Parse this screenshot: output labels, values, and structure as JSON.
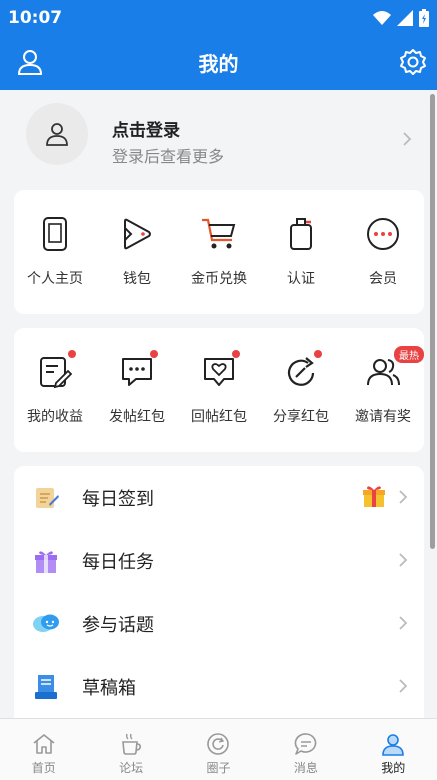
{
  "status_bar": {
    "time": "10:07"
  },
  "app_bar": {
    "title": "我的",
    "left_icon": "user-icon",
    "right_icon": "gear-icon"
  },
  "login": {
    "title": "点击登录",
    "subtitle": "登录后查看更多"
  },
  "quick_grid_1": [
    {
      "label": "个人主页",
      "icon": "phone-icon"
    },
    {
      "label": "钱包",
      "icon": "play-wallet-icon"
    },
    {
      "label": "金币兑换",
      "icon": "cart-icon"
    },
    {
      "label": "认证",
      "icon": "badge-icon"
    },
    {
      "label": "会员",
      "icon": "more-circle-icon"
    }
  ],
  "quick_grid_2": [
    {
      "label": "我的收益",
      "icon": "edit-doc-icon",
      "dot": true
    },
    {
      "label": "发帖红包",
      "icon": "chat-dots-icon",
      "dot": true
    },
    {
      "label": "回帖红包",
      "icon": "heart-chat-icon",
      "dot": true
    },
    {
      "label": "分享红包",
      "icon": "share-refresh-icon",
      "dot": true
    },
    {
      "label": "邀请有奖",
      "icon": "users-icon",
      "badge": "最热"
    }
  ],
  "list": [
    {
      "label": "每日签到",
      "icon": "scroll-icon",
      "gift": true
    },
    {
      "label": "每日任务",
      "icon": "gift-box-icon"
    },
    {
      "label": "参与话题",
      "icon": "chat-bubbles-icon"
    },
    {
      "label": "草稿箱",
      "icon": "draft-icon"
    }
  ],
  "tabs": [
    {
      "label": "首页",
      "icon": "home-icon"
    },
    {
      "label": "论坛",
      "icon": "coffee-icon"
    },
    {
      "label": "圈子",
      "icon": "circle-icon"
    },
    {
      "label": "消息",
      "icon": "message-icon"
    },
    {
      "label": "我的",
      "icon": "profile-icon",
      "active": true
    }
  ],
  "colors": {
    "primary": "#1a7ee8",
    "badge_red": "#e84242"
  }
}
